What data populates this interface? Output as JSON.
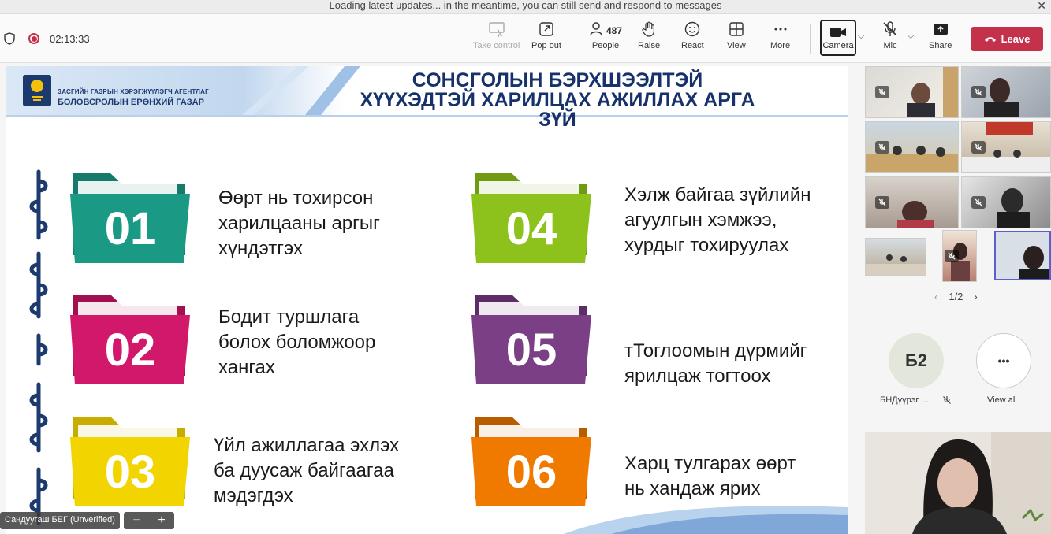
{
  "banner": {
    "text": "Loading latest updates... in the meantime, you can still send and respond to messages",
    "close": "✕"
  },
  "toolbar": {
    "timer": "02:13:33",
    "take_control": "Take control",
    "pop_out": "Pop out",
    "people_count": "487",
    "people": "People",
    "raise": "Raise",
    "react": "React",
    "view": "View",
    "more": "More",
    "camera": "Camera",
    "mic": "Mic",
    "share": "Share",
    "leave": "Leave",
    "icons": {
      "shield": "shield-icon",
      "record": "record-icon",
      "camera": "camera-icon",
      "mic": "mic-off-icon"
    }
  },
  "slide": {
    "org_line1": "ЗАСГИЙН ГАЗРЫН ХЭРЭГЖҮҮЛЭГЧ АГЕНТЛАГ",
    "org_line2": "БОЛОВСРОЛЫН ЕРӨНХИЙ ГАЗАР",
    "title": [
      "СОНСГОЛЫН БЭРХШЭЭЛТЭЙ",
      "ХҮҮХЭДТЭЙ ХАРИЛЦАХ АЖИЛЛАХ АРГА",
      "ЗҮЙ"
    ],
    "items": [
      {
        "num": "01",
        "lines": [
          "Өөрт нь тохирсон",
          "харилцааны аргыг",
          "хүндэтгэх"
        ],
        "color": "#1a9a84"
      },
      {
        "num": "02",
        "lines": [
          "Бодит туршлага",
          "болох боломжоор",
          "хангах"
        ],
        "color": "#d2186b"
      },
      {
        "num": "03",
        "lines": [
          "Үйл ажиллагаа эхлэх",
          "ба дуусаж байгаагаа",
          "мэдэгдэх"
        ],
        "color": "#f2d500"
      },
      {
        "num": "04",
        "lines": [
          "Хэлж байгаа зүйлийн",
          "агуулгын хэмжээ,",
          "хурдыг тохируулах"
        ],
        "color": "#8cc21b"
      },
      {
        "num": "05",
        "lines": [
          "тТоглоомын дүрмийг",
          "ярилцаж тогтоох"
        ],
        "color": "#7b3f86"
      },
      {
        "num": "06",
        "lines": [
          "Харц тулгарах өөрт",
          "нь хандаж ярих"
        ],
        "color": "#f07a00"
      }
    ]
  },
  "panel": {
    "pager": "1/2",
    "participant_initials": "Б2",
    "participant_name": "БНДүүрэг ...",
    "view_all": "View all",
    "more_glyph": "•••"
  },
  "presenter": {
    "name_tag": "Сандуугаш БЕГ (Unverified)",
    "zoom_out": "−",
    "zoom_in": "+"
  }
}
